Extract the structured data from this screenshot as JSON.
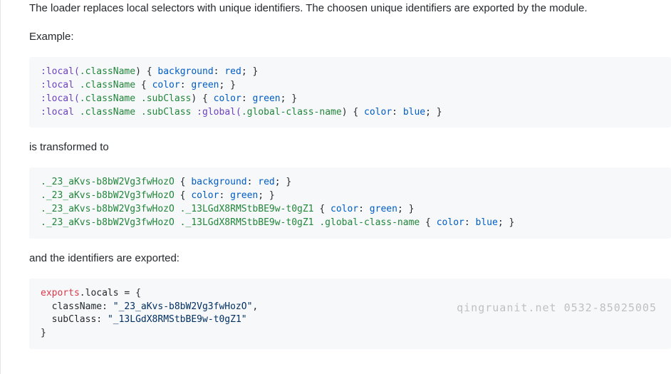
{
  "paragraphs": {
    "intro": "The loader replaces local selectors with unique identifiers. The choosen unique identifiers are exported by the module.",
    "example_label": "Example:",
    "transformed_label": "is transformed to",
    "exported_label": "and the identifiers are exported:"
  },
  "code1": {
    "l1": {
      "a": ":local(",
      "b": ".className",
      "c": ") { ",
      "d": "background",
      "e": ": ",
      "f": "red",
      "g": "; }"
    },
    "l2": {
      "a": ":local ",
      "b": ".className",
      "c": " { ",
      "d": "color",
      "e": ": ",
      "f": "green",
      "g": "; }"
    },
    "l3": {
      "a": ":local(",
      "b": ".className",
      "c": " ",
      "d": ".subClass",
      "e": ") { ",
      "f": "color",
      "g": ": ",
      "h": "green",
      "i": "; }"
    },
    "l4": {
      "a": ":local ",
      "b": ".className",
      "c": " ",
      "d": ".subClass",
      "e": " :global(",
      "f": ".global-class-name",
      "g": ") { ",
      "h": "color",
      "i": ": ",
      "j": "blue",
      "k": "; }"
    }
  },
  "code2": {
    "l1": {
      "a": "._23_aKvs-b8bW2Vg3fwHozO",
      "b": " { ",
      "c": "background",
      "d": ": ",
      "e": "red",
      "f": "; }"
    },
    "l2": {
      "a": "._23_aKvs-b8bW2Vg3fwHozO",
      "b": " { ",
      "c": "color",
      "d": ": ",
      "e": "green",
      "f": "; }"
    },
    "l3": {
      "a": "._23_aKvs-b8bW2Vg3fwHozO",
      "b": " ",
      "c": "._13LGdX8RMStbBE9w-t0gZ1",
      "d": " { ",
      "e": "color",
      "f": ": ",
      "g": "green",
      "h": "; }"
    },
    "l4": {
      "a": "._23_aKvs-b8bW2Vg3fwHozO",
      "b": " ",
      "c": "._13LGdX8RMStbBE9w-t0gZ1",
      "d": " ",
      "e": ".global-class-name",
      "f": " { ",
      "g": "color",
      "h": ": ",
      "i": "blue",
      "j": "; }"
    }
  },
  "code3": {
    "l1": {
      "a": "exports",
      "b": ".locals = {"
    },
    "l2": {
      "a": "  className",
      "b": ": ",
      "c": "\"_23_aKvs-b8bW2Vg3fwHozO\"",
      "d": ","
    },
    "l3": {
      "a": "  subClass",
      "b": ": ",
      "c": "\"_13LGdX8RMStbBE9w-t0gZ1\""
    },
    "l4": {
      "a": "}"
    }
  },
  "watermark": "qingruanit.net 0532-85025005"
}
